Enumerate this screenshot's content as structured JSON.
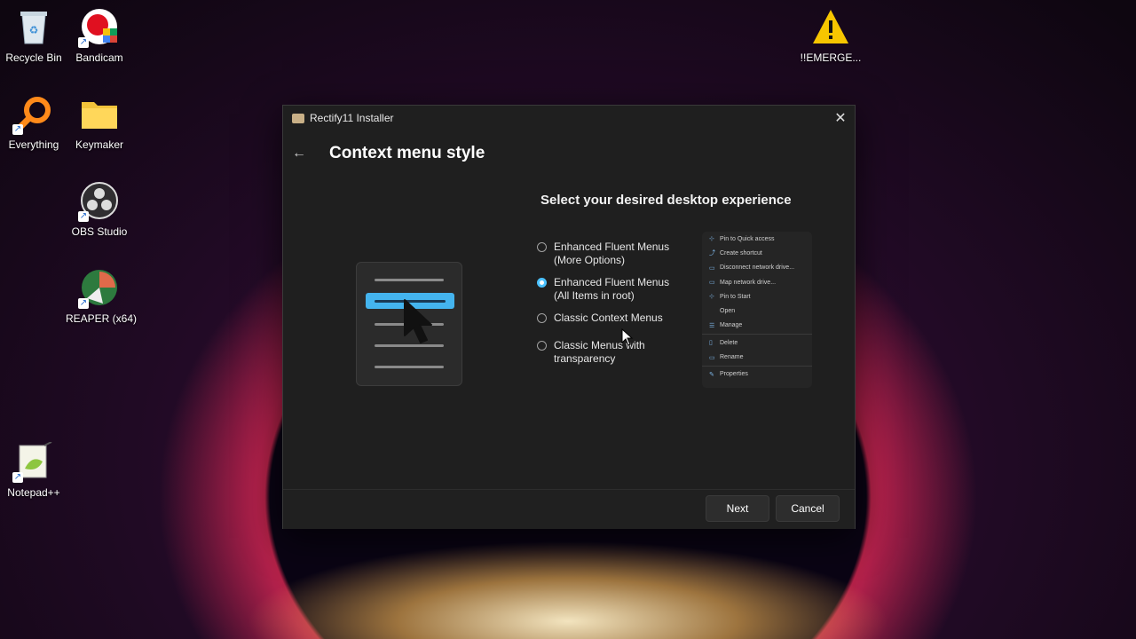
{
  "desktop": {
    "icons": [
      {
        "label": "Recycle Bin"
      },
      {
        "label": "Bandicam"
      },
      {
        "label": "Everything"
      },
      {
        "label": "Keymaker"
      },
      {
        "label": "OBS Studio"
      },
      {
        "label": "REAPER (x64)"
      },
      {
        "label": "Notepad++"
      },
      {
        "label": "!!EMERGE..."
      }
    ]
  },
  "window": {
    "title": "Rectify11 Installer",
    "close_glyph": "✕",
    "back_glyph": "←",
    "page_title": "Context menu style",
    "subtitle": "Select your desired desktop experience",
    "options": [
      {
        "label": "Enhanced Fluent Menus (More Options)",
        "selected": false
      },
      {
        "label": "Enhanced Fluent Menus (All Items in root)",
        "selected": true
      },
      {
        "label": "Classic Context Menus",
        "selected": false
      },
      {
        "label": "Classic Menus with transparency",
        "selected": false
      }
    ],
    "preview_items": [
      {
        "icon": "pin-icon",
        "label": "Pin to Quick access"
      },
      {
        "icon": "shortcut-icon",
        "label": "Create shortcut"
      },
      {
        "icon": "network-drive-icon",
        "label": "Disconnect network drive..."
      },
      {
        "icon": "map-drive-icon",
        "label": "Map network drive..."
      },
      {
        "icon": "pin-icon",
        "label": "Pin to Start"
      },
      {
        "icon": "",
        "label": "Open"
      },
      {
        "icon": "manage-icon",
        "label": "Manage"
      },
      {
        "icon": "delete-icon",
        "label": "Delete"
      },
      {
        "icon": "rename-icon",
        "label": "Rename"
      },
      {
        "icon": "properties-icon",
        "label": "Properties"
      }
    ],
    "buttons": {
      "next": "Next",
      "cancel": "Cancel"
    }
  }
}
